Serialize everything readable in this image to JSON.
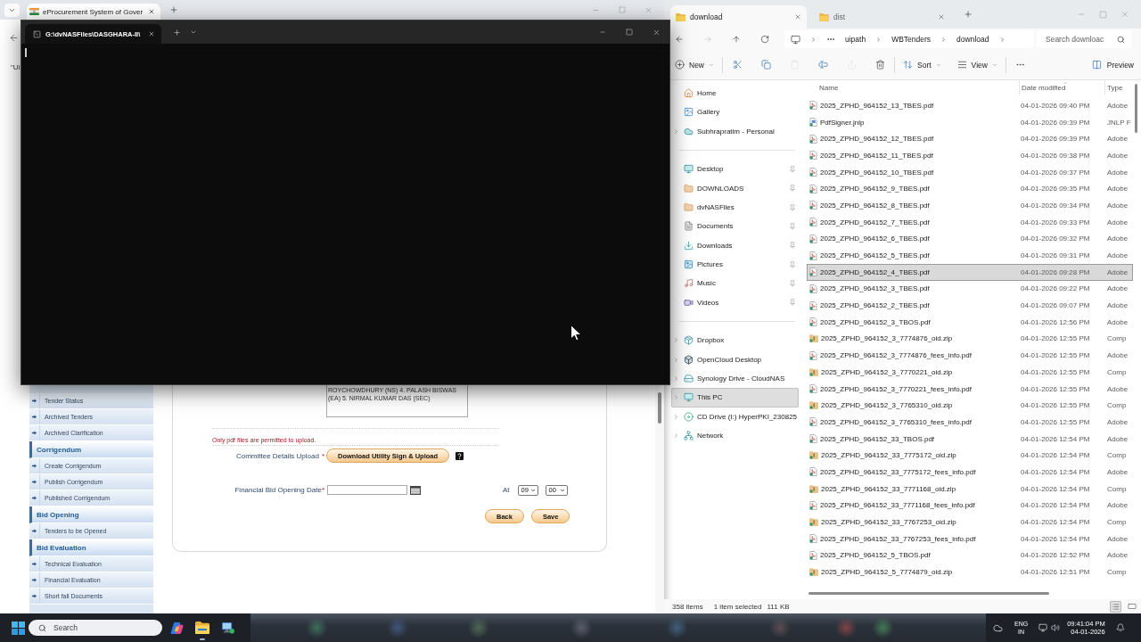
{
  "browser": {
    "tabs": [
      {
        "title": "eProcurement System of Gover",
        "selected": true
      }
    ],
    "notice": "\"Ui",
    "sidebar": [
      {
        "kind": "item",
        "label": "Tender Status"
      },
      {
        "kind": "item",
        "label": "Archived Tenders"
      },
      {
        "kind": "item",
        "label": "Archived Clarification"
      },
      {
        "kind": "section",
        "label": "Corrigendum"
      },
      {
        "kind": "item",
        "label": "Create Corrigendum"
      },
      {
        "kind": "item",
        "label": "Publish Corrigendum"
      },
      {
        "kind": "item",
        "label": "Published Corrigendum"
      },
      {
        "kind": "section",
        "label": "Bid Opening"
      },
      {
        "kind": "item",
        "label": "Tenders to be Opened"
      },
      {
        "kind": "section",
        "label": "Bid Evaluation"
      },
      {
        "kind": "item",
        "label": "Technical Evaluation"
      },
      {
        "kind": "item",
        "label": "Financial Evaluation"
      },
      {
        "kind": "item",
        "label": "Short fall Documents"
      }
    ],
    "form": {
      "committee_field": {
        "value": "ROYCHOWDHURY (NS) 4. PALASH BISWAS (EA) 5. NIRMAL KUMAR DAS (SEC)"
      },
      "upload_note": "Only pdf files are permitted to upload.",
      "upload": {
        "label": "Committee Details Upload",
        "required_mark": "*",
        "button": "Download Utility Sign & Upload"
      },
      "opening_date": {
        "label": "Financial Bid Opening Date",
        "required_mark": "*",
        "at_label": "At",
        "hour": "09",
        "minute": "00"
      },
      "buttons": [
        "Back",
        "Save"
      ]
    }
  },
  "terminal": {
    "tabs": [
      {
        "title": "G:\\dvNASFiles\\DASGHARA-II\\",
        "selected": true
      }
    ]
  },
  "explorer": {
    "tabs": [
      {
        "title": "download",
        "selected": true
      },
      {
        "title": "dist",
        "selected": false
      }
    ],
    "nav_buttons": [
      {
        "kind": "back",
        "disabled": false
      },
      {
        "kind": "forward",
        "disabled": true
      },
      {
        "kind": "up",
        "disabled": false
      },
      {
        "kind": "refresh",
        "disabled": false
      }
    ],
    "breadcrumb": [
      "uipath",
      "WBTenders",
      "download"
    ],
    "search": {
      "placeholder": "Search downloac"
    },
    "toolbar": [
      [
        {
          "kind": "new",
          "label": "New",
          "disabled": false
        }
      ],
      [
        {
          "kind": "cut",
          "disabled": false
        },
        {
          "kind": "copy",
          "disabled": false
        },
        {
          "kind": "paste",
          "disabled": true
        },
        {
          "kind": "rename",
          "disabled": false
        },
        {
          "kind": "share",
          "disabled": true
        },
        {
          "kind": "delete",
          "disabled": false
        }
      ],
      [
        {
          "kind": "sort",
          "label": "Sort",
          "disabled": false
        },
        {
          "kind": "view",
          "label": "View",
          "disabled": false
        }
      ],
      [
        {
          "kind": "more",
          "disabled": false
        }
      ]
    ],
    "preview_button": "Preview",
    "nav_pane": [
      {
        "items": [
          {
            "kind": "home",
            "label": "Home",
            "expandable": false,
            "pinned": false,
            "selected": false
          },
          {
            "kind": "gallery",
            "label": "Gallery",
            "expandable": false,
            "pinned": false,
            "selected": false
          },
          {
            "kind": "cloud",
            "label": "Subhrapratim - Personal",
            "expandable": true,
            "pinned": false,
            "selected": false
          }
        ]
      },
      {
        "items": [
          {
            "kind": "desktop",
            "label": "Desktop",
            "expandable": false,
            "pinned": true,
            "selected": false
          },
          {
            "kind": "folder",
            "label": "DOWNLOADS",
            "expandable": false,
            "pinned": true,
            "selected": false
          },
          {
            "kind": "folder",
            "label": "dvNASFiles",
            "expandable": false,
            "pinned": true,
            "selected": false
          },
          {
            "kind": "documents",
            "label": "Documents",
            "expandable": false,
            "pinned": true,
            "selected": false
          },
          {
            "kind": "downloads",
            "label": "Downloads",
            "expandable": false,
            "pinned": true,
            "selected": false
          },
          {
            "kind": "pictures",
            "label": "Pictures",
            "expandable": false,
            "pinned": true,
            "selected": false
          },
          {
            "kind": "music",
            "label": "Music",
            "expandable": false,
            "pinned": true,
            "selected": false
          },
          {
            "kind": "videos",
            "label": "Videos",
            "expandable": false,
            "pinned": true,
            "selected": false
          }
        ]
      },
      {
        "items": [
          {
            "kind": "dropbox",
            "label": "Dropbox",
            "expandable": true,
            "pinned": false,
            "selected": false
          },
          {
            "kind": "app",
            "label": "OpenCloud Desktop",
            "expandable": true,
            "pinned": false,
            "selected": false
          },
          {
            "kind": "drive",
            "label": "Synology Drive - CloudNAS",
            "expandable": true,
            "pinned": false,
            "selected": false
          },
          {
            "kind": "pc",
            "label": "This PC",
            "expandable": true,
            "pinned": false,
            "selected": true
          },
          {
            "kind": "disc",
            "label": "CD Drive (I:) HyperPKI_230825",
            "expandable": true,
            "pinned": false,
            "selected": false
          },
          {
            "kind": "network",
            "label": "Network",
            "expandable": true,
            "pinned": false,
            "selected": false
          }
        ]
      }
    ],
    "columns": [
      "Name",
      "Date modified",
      "Type"
    ],
    "files": [
      {
        "kind": "pdf",
        "name": "2025_ZPHD_964152_13_TBES.pdf",
        "date": "04-01-2026 09:40 PM",
        "type": "Adobe",
        "selected": false
      },
      {
        "kind": "jnlp",
        "name": "PdfSigner.jnlp",
        "date": "04-01-2026 09:39 PM",
        "type": "JNLP F",
        "selected": false
      },
      {
        "kind": "pdf",
        "name": "2025_ZPHD_964152_12_TBES.pdf",
        "date": "04-01-2026 09:39 PM",
        "type": "Adobe",
        "selected": false
      },
      {
        "kind": "pdf",
        "name": "2025_ZPHD_964152_11_TBES.pdf",
        "date": "04-01-2026 09:38 PM",
        "type": "Adobe",
        "selected": false
      },
      {
        "kind": "pdf",
        "name": "2025_ZPHD_964152_10_TBES.pdf",
        "date": "04-01-2026 09:37 PM",
        "type": "Adobe",
        "selected": false
      },
      {
        "kind": "pdf",
        "name": "2025_ZPHD_964152_9_TBES.pdf",
        "date": "04-01-2026 09:35 PM",
        "type": "Adobe",
        "selected": false
      },
      {
        "kind": "pdf",
        "name": "2025_ZPHD_964152_8_TBES.pdf",
        "date": "04-01-2026 09:34 PM",
        "type": "Adobe",
        "selected": false
      },
      {
        "kind": "pdf",
        "name": "2025_ZPHD_964152_7_TBES.pdf",
        "date": "04-01-2026 09:33 PM",
        "type": "Adobe",
        "selected": false
      },
      {
        "kind": "pdf",
        "name": "2025_ZPHD_964152_6_TBES.pdf",
        "date": "04-01-2026 09:32 PM",
        "type": "Adobe",
        "selected": false
      },
      {
        "kind": "pdf",
        "name": "2025_ZPHD_964152_5_TBES.pdf",
        "date": "04-01-2026 09:31 PM",
        "type": "Adobe",
        "selected": false
      },
      {
        "kind": "pdf",
        "name": "2025_ZPHD_964152_4_TBES.pdf",
        "date": "04-01-2026 09:28 PM",
        "type": "Adobe",
        "selected": true
      },
      {
        "kind": "pdf",
        "name": "2025_ZPHD_964152_3_TBES.pdf",
        "date": "04-01-2026 09:22 PM",
        "type": "Adobe",
        "selected": false
      },
      {
        "kind": "pdf",
        "name": "2025_ZPHD_964152_2_TBES.pdf",
        "date": "04-01-2026 09:07 PM",
        "type": "Adobe",
        "selected": false
      },
      {
        "kind": "pdf",
        "name": "2025_ZPHD_964152_3_TBOS.pdf",
        "date": "04-01-2026 12:56 PM",
        "type": "Adobe",
        "selected": false
      },
      {
        "kind": "zip",
        "name": "2025_ZPHD_964152_3_7774876_oid.zip",
        "date": "04-01-2026 12:55 PM",
        "type": "Comp",
        "selected": false
      },
      {
        "kind": "pdf",
        "name": "2025_ZPHD_964152_3_7774876_fees_info.pdf",
        "date": "04-01-2026 12:55 PM",
        "type": "Adobe",
        "selected": false
      },
      {
        "kind": "zip",
        "name": "2025_ZPHD_964152_3_7770221_oid.zip",
        "date": "04-01-2026 12:55 PM",
        "type": "Comp",
        "selected": false
      },
      {
        "kind": "pdf",
        "name": "2025_ZPHD_964152_3_7770221_fees_info.pdf",
        "date": "04-01-2026 12:55 PM",
        "type": "Adobe",
        "selected": false
      },
      {
        "kind": "zip",
        "name": "2025_ZPHD_964152_3_7765310_oid.zip",
        "date": "04-01-2026 12:55 PM",
        "type": "Comp",
        "selected": false
      },
      {
        "kind": "pdf",
        "name": "2025_ZPHD_964152_3_7765310_fees_info.pdf",
        "date": "04-01-2026 12:55 PM",
        "type": "Adobe",
        "selected": false
      },
      {
        "kind": "pdf",
        "name": "2025_ZPHD_964152_33_TBOS.pdf",
        "date": "04-01-2026 12:54 PM",
        "type": "Adobe",
        "selected": false
      },
      {
        "kind": "zip",
        "name": "2025_ZPHD_964152_33_7775172_oid.zip",
        "date": "04-01-2026 12:54 PM",
        "type": "Comp",
        "selected": false
      },
      {
        "kind": "pdf",
        "name": "2025_ZPHD_964152_33_7775172_fees_info.pdf",
        "date": "04-01-2026 12:54 PM",
        "type": "Adobe",
        "selected": false
      },
      {
        "kind": "zip",
        "name": "2025_ZPHD_964152_33_7771168_oid.zip",
        "date": "04-01-2026 12:54 PM",
        "type": "Comp",
        "selected": false
      },
      {
        "kind": "pdf",
        "name": "2025_ZPHD_964152_33_7771168_fees_info.pdf",
        "date": "04-01-2026 12:54 PM",
        "type": "Adobe",
        "selected": false
      },
      {
        "kind": "zip",
        "name": "2025_ZPHD_964152_33_7767253_oid.zip",
        "date": "04-01-2026 12:54 PM",
        "type": "Comp",
        "selected": false
      },
      {
        "kind": "pdf",
        "name": "2025_ZPHD_964152_33_7767253_fees_info.pdf",
        "date": "04-01-2026 12:54 PM",
        "type": "Adobe",
        "selected": false
      },
      {
        "kind": "pdf",
        "name": "2025_ZPHD_964152_5_TBOS.pdf",
        "date": "04-01-2026 12:52 PM",
        "type": "Adobe",
        "selected": false
      },
      {
        "kind": "zip",
        "name": "2025_ZPHD_964152_5_7774879_oid.zip",
        "date": "04-01-2026 12:51 PM",
        "type": "Comp",
        "selected": false
      }
    ],
    "status": {
      "item_count": "358 items",
      "selection": "1 item selected",
      "size": "111 KB"
    },
    "view_modes": [
      {
        "kind": "details",
        "selected": true
      },
      {
        "kind": "tiles",
        "selected": false
      }
    ]
  },
  "taskbar": {
    "search": {
      "placeholder": "Search"
    },
    "apps": [
      {
        "kind": "assistant",
        "running": false
      },
      {
        "kind": "files",
        "running": true
      },
      {
        "kind": "remote",
        "running": false
      }
    ],
    "language": [
      "ENG",
      "IN"
    ],
    "time": "09:41:04 PM",
    "date": "04-01-2026"
  }
}
